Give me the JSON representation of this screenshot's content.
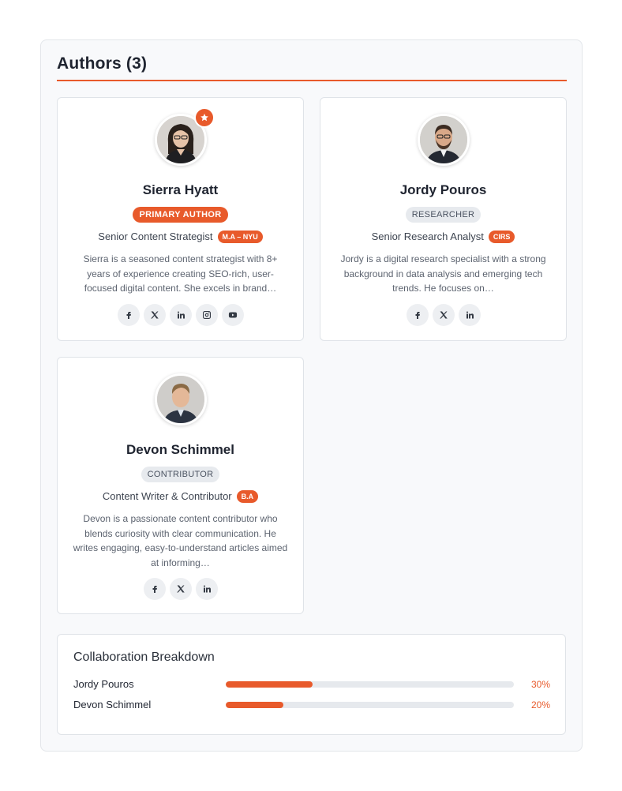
{
  "panel": {
    "title": "Authors (3)"
  },
  "authors": [
    {
      "name": "Sierra Hyatt",
      "role": "PRIMARY AUTHOR",
      "role_style": "primary",
      "job_title": "Senior Content Strategist",
      "degree": "M.A – NYU",
      "bio": "Sierra is a seasoned content strategist with 8+ years of experience creating SEO-rich, user-focused digital content. She excels in brand…",
      "primary": true,
      "socials": [
        "facebook-icon",
        "x-icon",
        "linkedin-icon",
        "instagram-icon",
        "youtube-icon"
      ]
    },
    {
      "name": "Jordy Pouros",
      "role": "RESEARCHER",
      "role_style": "secondary",
      "job_title": "Senior Research Analyst",
      "degree": "CIRS",
      "bio": "Jordy is a digital research specialist with a strong background in data analysis and emerging tech trends. He focuses on…",
      "primary": false,
      "socials": [
        "facebook-icon",
        "x-icon",
        "linkedin-icon"
      ]
    },
    {
      "name": "Devon Schimmel",
      "role": "CONTRIBUTOR",
      "role_style": "secondary",
      "job_title": "Content Writer & Contributor",
      "degree": "B.A",
      "bio": "Devon is a passionate content contributor who blends curiosity with clear communication. He writes engaging, easy-to-understand articles aimed at informing…",
      "primary": false,
      "socials": [
        "facebook-icon",
        "x-icon",
        "linkedin-icon"
      ]
    }
  ],
  "collaboration": {
    "title": "Collaboration Breakdown",
    "rows": [
      {
        "name": "Jordy Pouros",
        "percent_label": "30%",
        "percent": 30
      },
      {
        "name": "Devon Schimmel",
        "percent_label": "20%",
        "percent": 20
      }
    ]
  },
  "colors": {
    "accent": "#e85a2b",
    "panel_bg": "#f8f9fb",
    "badge_gray": "#e7eaee"
  }
}
